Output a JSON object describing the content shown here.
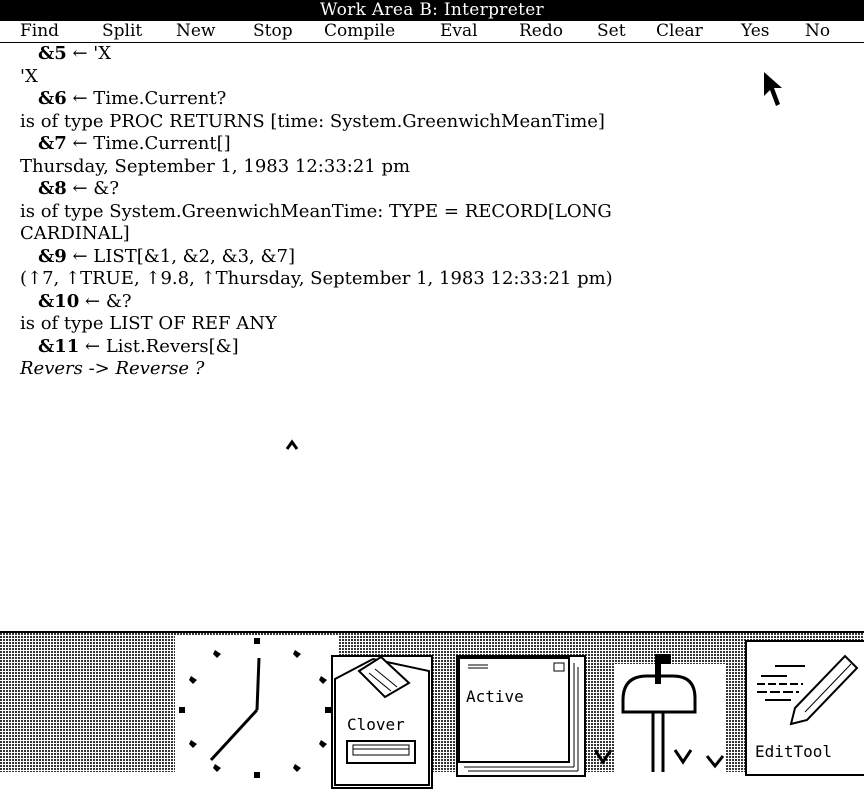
{
  "window": {
    "title": "Work Area B: Interpreter"
  },
  "menu": [
    "Find",
    "Split",
    "New",
    "Stop",
    "Compile",
    "Eval",
    "Redo",
    "Set",
    "Clear",
    "Yes",
    "No"
  ],
  "interpreter": {
    "lines": [
      {
        "kind": "cmd",
        "prompt": "&5",
        "text": " ← 'X"
      },
      {
        "kind": "out",
        "text": "'X"
      },
      {
        "kind": "cmd",
        "prompt": "&6",
        "text": " ← Time.Current?"
      },
      {
        "kind": "out",
        "text": "is of type PROC RETURNS [time: System.GreenwichMeanTime]"
      },
      {
        "kind": "cmd",
        "prompt": "&7",
        "text": " ← Time.Current[]"
      },
      {
        "kind": "out",
        "text": "Thursday, September 1, 1983 12:33:21 pm"
      },
      {
        "kind": "cmd",
        "prompt": "&8",
        "text": " ← &?"
      },
      {
        "kind": "out",
        "text": "is of type System.GreenwichMeanTime: TYPE = RECORD[LONG"
      },
      {
        "kind": "out",
        "text": "CARDINAL]"
      },
      {
        "kind": "cmd",
        "prompt": "&9",
        "text": " ← LIST[&1, &2, &3, &7]"
      },
      {
        "kind": "out",
        "text": "(↑7, ↑TRUE, ↑9.8, ↑Thursday, September 1, 1983 12:33:21 pm)"
      },
      {
        "kind": "cmd",
        "prompt": "&10",
        "text": " ← &?"
      },
      {
        "kind": "out",
        "text": "is of type LIST OF REF ANY"
      },
      {
        "kind": "cmd",
        "prompt": "&11",
        "text": " ← List.Revers[&]"
      },
      {
        "kind": "italic",
        "text": "Revers -> Reverse ?"
      }
    ]
  },
  "desktop": {
    "icons": [
      {
        "label": "",
        "icon": "clock-icon"
      },
      {
        "label": "Clover",
        "icon": "clover-disk-icon"
      },
      {
        "label": "Active",
        "icon": "active-folder-icon"
      },
      {
        "label": "",
        "icon": "mailbox-icon"
      },
      {
        "label": "EditTool",
        "icon": "edit-tool-icon"
      }
    ]
  }
}
